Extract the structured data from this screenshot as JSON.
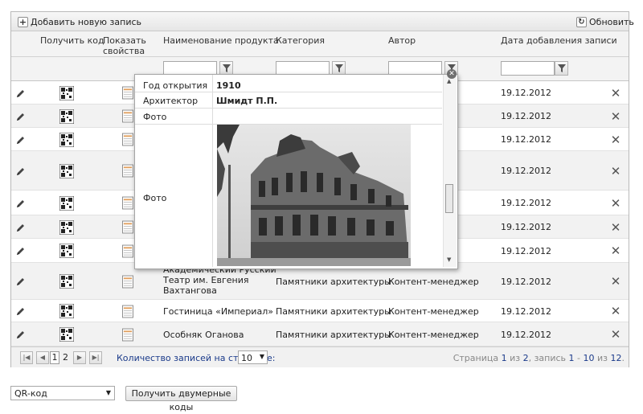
{
  "toolbar": {
    "add_label": "Добавить новую запись",
    "refresh_label": "Обновить"
  },
  "columns": {
    "get_code": "Получить код",
    "show_props_line1": "Показать",
    "show_props_line2": "свойства",
    "product_name": "Наименование продукта",
    "category": "Категория",
    "author": "Автор",
    "date_added": "Дата добавления записи"
  },
  "rows": [
    {
      "name": "",
      "category": "",
      "author": "",
      "date": "19.12.2012"
    },
    {
      "name": "",
      "category": "",
      "author": "",
      "date": "19.12.2012"
    },
    {
      "name": "",
      "category": "",
      "author": "",
      "date": "19.12.2012"
    },
    {
      "name": "",
      "category": "",
      "author": "",
      "date": "19.12.2012"
    },
    {
      "name": "",
      "category": "",
      "author": "",
      "date": "19.12.2012"
    },
    {
      "name": "",
      "category": "",
      "author": "",
      "date": "19.12.2012"
    },
    {
      "name": "",
      "category": "",
      "author": "",
      "date": "19.12.2012"
    },
    {
      "name_line1": "Академический Русский",
      "name_line2": "Театр им. Евгения",
      "name_line3": "Вахтангова",
      "category": "Памятники архитектуры",
      "author": "Контент-менеджер",
      "date": "19.12.2012"
    },
    {
      "name": "Гостиница «Империал»",
      "category": "Памятники архитектуры",
      "author": "Контент-менеджер",
      "date": "19.12.2012"
    },
    {
      "name": "Особняк Оганова",
      "category": "Памятники архитектуры",
      "author": "Контент-менеджер",
      "date": "19.12.2012"
    }
  ],
  "popup": {
    "rows": [
      {
        "label": "Год открытия",
        "value": "1910"
      },
      {
        "label": "Архитектор",
        "value": "Шмидт П.П."
      },
      {
        "label": "Фото",
        "value": ""
      },
      {
        "label": "Фото",
        "value": ""
      }
    ]
  },
  "pager": {
    "current_page": "1",
    "page_2": "2",
    "per_page_label": "Количество записей на странице:",
    "per_page_value": "10",
    "status_prefix": "Страница ",
    "status_page": "1",
    "status_of1": " из ",
    "status_pages": "2",
    "status_mid": ", запись ",
    "status_from": "1",
    "status_dash": " - ",
    "status_to": "10",
    "status_of2": " из ",
    "status_total": "12",
    "status_end": "."
  },
  "bottom": {
    "select_value": "QR-код",
    "button_label": "Получить двумерные коды"
  },
  "colors": {
    "link_blue": "#1a3a8a",
    "border": "#b9b9b9"
  }
}
